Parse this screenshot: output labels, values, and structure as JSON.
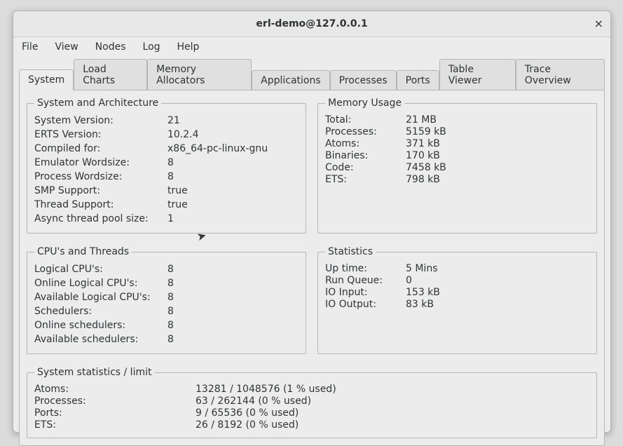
{
  "window": {
    "title": "erl-demo@127.0.0.1",
    "close": "×"
  },
  "menu": {
    "file": "File",
    "view": "View",
    "nodes": "Nodes",
    "log": "Log",
    "help": "Help"
  },
  "tabs": {
    "system": "System",
    "load_charts": "Load Charts",
    "memory_allocators": "Memory Allocators",
    "applications": "Applications",
    "processes": "Processes",
    "ports": "Ports",
    "table_viewer": "Table Viewer",
    "trace_overview": "Trace Overview"
  },
  "groups": {
    "sys_arch": {
      "legend": "System and Architecture",
      "rows": {
        "system_version_l": "System Version:",
        "system_version_v": "21",
        "erts_version_l": "ERTS Version:",
        "erts_version_v": "10.2.4",
        "compiled_for_l": "Compiled for:",
        "compiled_for_v": "x86_64-pc-linux-gnu",
        "emu_ws_l": "Emulator Wordsize:",
        "emu_ws_v": "8",
        "proc_ws_l": "Process Wordsize:",
        "proc_ws_v": "8",
        "smp_l": "SMP Support:",
        "smp_v": "true",
        "thread_l": "Thread Support:",
        "thread_v": "true",
        "async_l": "Async thread pool size:",
        "async_v": "1"
      }
    },
    "mem": {
      "legend": "Memory Usage",
      "rows": {
        "total_l": "Total:",
        "total_v": "21 MB",
        "procs_l": "Processes:",
        "procs_v": "5159 kB",
        "atoms_l": "Atoms:",
        "atoms_v": "371 kB",
        "bins_l": "Binaries:",
        "bins_v": "170 kB",
        "code_l": "Code:",
        "code_v": "7458 kB",
        "ets_l": "ETS:",
        "ets_v": "798 kB"
      }
    },
    "cpu": {
      "legend": "CPU's and Threads",
      "rows": {
        "logical_l": "Logical CPU's:",
        "logical_v": "8",
        "online_l": "Online Logical CPU's:",
        "online_v": "8",
        "avail_l": "Available Logical CPU's:",
        "avail_v": "8",
        "sched_l": "Schedulers:",
        "sched_v": "8",
        "osched_l": "Online schedulers:",
        "osched_v": "8",
        "asched_l": "Available schedulers:",
        "asched_v": "8"
      }
    },
    "stats": {
      "legend": "Statistics",
      "rows": {
        "uptime_l": "Up time:",
        "uptime_v": "5 Mins",
        "runq_l": "Run Queue:",
        "runq_v": "0",
        "ioin_l": "IO Input:",
        "ioin_v": "153 kB",
        "ioout_l": "IO Output:",
        "ioout_v": "83 kB"
      }
    },
    "limits": {
      "legend": "System statistics / limit",
      "rows": {
        "atoms_l": "Atoms:",
        "atoms_v": "13281 / 1048576 (1 % used)",
        "procs_l": "Processes:",
        "procs_v": "63 / 262144 (0 % used)",
        "ports_l": "Ports:",
        "ports_v": "9 / 65536 (0 % used)",
        "ets_l": "ETS:",
        "ets_v": "26 / 8192 (0 % used)"
      }
    }
  }
}
